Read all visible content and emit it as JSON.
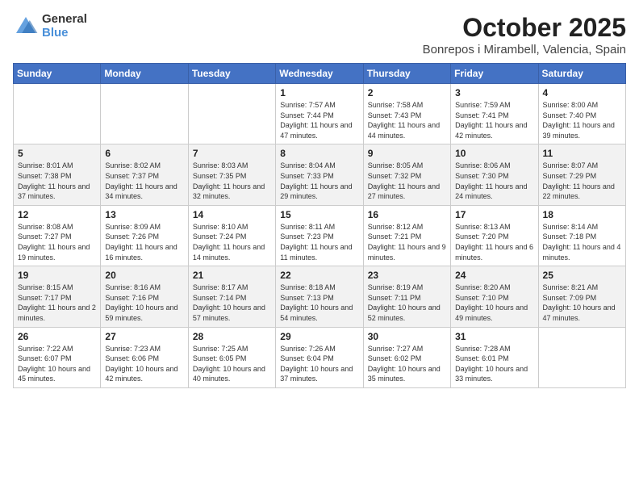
{
  "logo": {
    "general": "General",
    "blue": "Blue"
  },
  "header": {
    "month": "October 2025",
    "location": "Bonrepos i Mirambell, Valencia, Spain"
  },
  "weekdays": [
    "Sunday",
    "Monday",
    "Tuesday",
    "Wednesday",
    "Thursday",
    "Friday",
    "Saturday"
  ],
  "weeks": [
    [
      {
        "day": "",
        "sunrise": "",
        "sunset": "",
        "daylight": ""
      },
      {
        "day": "",
        "sunrise": "",
        "sunset": "",
        "daylight": ""
      },
      {
        "day": "",
        "sunrise": "",
        "sunset": "",
        "daylight": ""
      },
      {
        "day": "1",
        "sunrise": "Sunrise: 7:57 AM",
        "sunset": "Sunset: 7:44 PM",
        "daylight": "Daylight: 11 hours and 47 minutes."
      },
      {
        "day": "2",
        "sunrise": "Sunrise: 7:58 AM",
        "sunset": "Sunset: 7:43 PM",
        "daylight": "Daylight: 11 hours and 44 minutes."
      },
      {
        "day": "3",
        "sunrise": "Sunrise: 7:59 AM",
        "sunset": "Sunset: 7:41 PM",
        "daylight": "Daylight: 11 hours and 42 minutes."
      },
      {
        "day": "4",
        "sunrise": "Sunrise: 8:00 AM",
        "sunset": "Sunset: 7:40 PM",
        "daylight": "Daylight: 11 hours and 39 minutes."
      }
    ],
    [
      {
        "day": "5",
        "sunrise": "Sunrise: 8:01 AM",
        "sunset": "Sunset: 7:38 PM",
        "daylight": "Daylight: 11 hours and 37 minutes."
      },
      {
        "day": "6",
        "sunrise": "Sunrise: 8:02 AM",
        "sunset": "Sunset: 7:37 PM",
        "daylight": "Daylight: 11 hours and 34 minutes."
      },
      {
        "day": "7",
        "sunrise": "Sunrise: 8:03 AM",
        "sunset": "Sunset: 7:35 PM",
        "daylight": "Daylight: 11 hours and 32 minutes."
      },
      {
        "day": "8",
        "sunrise": "Sunrise: 8:04 AM",
        "sunset": "Sunset: 7:33 PM",
        "daylight": "Daylight: 11 hours and 29 minutes."
      },
      {
        "day": "9",
        "sunrise": "Sunrise: 8:05 AM",
        "sunset": "Sunset: 7:32 PM",
        "daylight": "Daylight: 11 hours and 27 minutes."
      },
      {
        "day": "10",
        "sunrise": "Sunrise: 8:06 AM",
        "sunset": "Sunset: 7:30 PM",
        "daylight": "Daylight: 11 hours and 24 minutes."
      },
      {
        "day": "11",
        "sunrise": "Sunrise: 8:07 AM",
        "sunset": "Sunset: 7:29 PM",
        "daylight": "Daylight: 11 hours and 22 minutes."
      }
    ],
    [
      {
        "day": "12",
        "sunrise": "Sunrise: 8:08 AM",
        "sunset": "Sunset: 7:27 PM",
        "daylight": "Daylight: 11 hours and 19 minutes."
      },
      {
        "day": "13",
        "sunrise": "Sunrise: 8:09 AM",
        "sunset": "Sunset: 7:26 PM",
        "daylight": "Daylight: 11 hours and 16 minutes."
      },
      {
        "day": "14",
        "sunrise": "Sunrise: 8:10 AM",
        "sunset": "Sunset: 7:24 PM",
        "daylight": "Daylight: 11 hours and 14 minutes."
      },
      {
        "day": "15",
        "sunrise": "Sunrise: 8:11 AM",
        "sunset": "Sunset: 7:23 PM",
        "daylight": "Daylight: 11 hours and 11 minutes."
      },
      {
        "day": "16",
        "sunrise": "Sunrise: 8:12 AM",
        "sunset": "Sunset: 7:21 PM",
        "daylight": "Daylight: 11 hours and 9 minutes."
      },
      {
        "day": "17",
        "sunrise": "Sunrise: 8:13 AM",
        "sunset": "Sunset: 7:20 PM",
        "daylight": "Daylight: 11 hours and 6 minutes."
      },
      {
        "day": "18",
        "sunrise": "Sunrise: 8:14 AM",
        "sunset": "Sunset: 7:18 PM",
        "daylight": "Daylight: 11 hours and 4 minutes."
      }
    ],
    [
      {
        "day": "19",
        "sunrise": "Sunrise: 8:15 AM",
        "sunset": "Sunset: 7:17 PM",
        "daylight": "Daylight: 11 hours and 2 minutes."
      },
      {
        "day": "20",
        "sunrise": "Sunrise: 8:16 AM",
        "sunset": "Sunset: 7:16 PM",
        "daylight": "Daylight: 10 hours and 59 minutes."
      },
      {
        "day": "21",
        "sunrise": "Sunrise: 8:17 AM",
        "sunset": "Sunset: 7:14 PM",
        "daylight": "Daylight: 10 hours and 57 minutes."
      },
      {
        "day": "22",
        "sunrise": "Sunrise: 8:18 AM",
        "sunset": "Sunset: 7:13 PM",
        "daylight": "Daylight: 10 hours and 54 minutes."
      },
      {
        "day": "23",
        "sunrise": "Sunrise: 8:19 AM",
        "sunset": "Sunset: 7:11 PM",
        "daylight": "Daylight: 10 hours and 52 minutes."
      },
      {
        "day": "24",
        "sunrise": "Sunrise: 8:20 AM",
        "sunset": "Sunset: 7:10 PM",
        "daylight": "Daylight: 10 hours and 49 minutes."
      },
      {
        "day": "25",
        "sunrise": "Sunrise: 8:21 AM",
        "sunset": "Sunset: 7:09 PM",
        "daylight": "Daylight: 10 hours and 47 minutes."
      }
    ],
    [
      {
        "day": "26",
        "sunrise": "Sunrise: 7:22 AM",
        "sunset": "Sunset: 6:07 PM",
        "daylight": "Daylight: 10 hours and 45 minutes."
      },
      {
        "day": "27",
        "sunrise": "Sunrise: 7:23 AM",
        "sunset": "Sunset: 6:06 PM",
        "daylight": "Daylight: 10 hours and 42 minutes."
      },
      {
        "day": "28",
        "sunrise": "Sunrise: 7:25 AM",
        "sunset": "Sunset: 6:05 PM",
        "daylight": "Daylight: 10 hours and 40 minutes."
      },
      {
        "day": "29",
        "sunrise": "Sunrise: 7:26 AM",
        "sunset": "Sunset: 6:04 PM",
        "daylight": "Daylight: 10 hours and 37 minutes."
      },
      {
        "day": "30",
        "sunrise": "Sunrise: 7:27 AM",
        "sunset": "Sunset: 6:02 PM",
        "daylight": "Daylight: 10 hours and 35 minutes."
      },
      {
        "day": "31",
        "sunrise": "Sunrise: 7:28 AM",
        "sunset": "Sunset: 6:01 PM",
        "daylight": "Daylight: 10 hours and 33 minutes."
      },
      {
        "day": "",
        "sunrise": "",
        "sunset": "",
        "daylight": ""
      }
    ]
  ]
}
